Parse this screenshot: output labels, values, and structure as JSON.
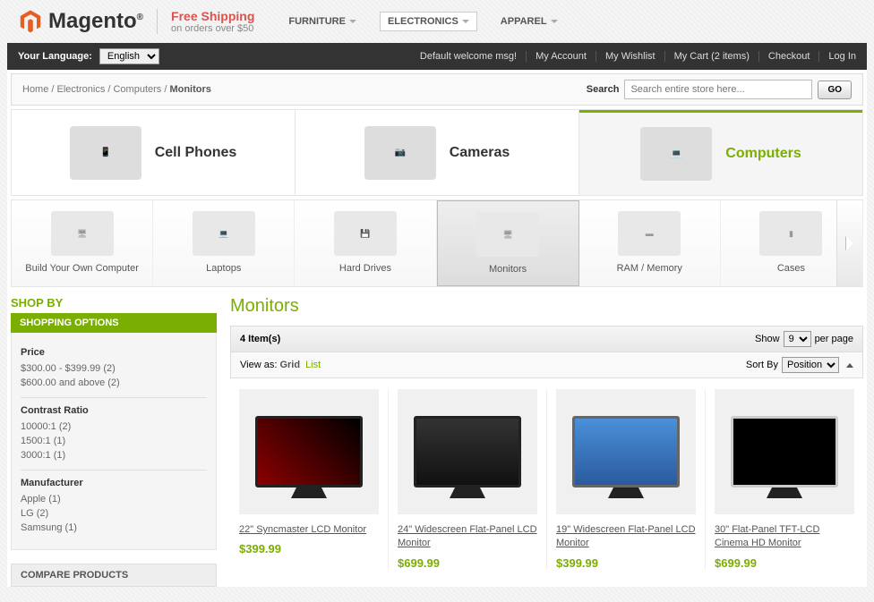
{
  "header": {
    "logo": "Magento",
    "reg": "®",
    "ship_title": "Free Shipping",
    "ship_sub": "on orders over $50",
    "nav": [
      "FURNITURE",
      "ELECTRONICS",
      "APPAREL"
    ]
  },
  "toolbar": {
    "lang_label": "Your Language:",
    "lang_value": "English",
    "welcome": "Default welcome msg!",
    "links": [
      "My Account",
      "My Wishlist",
      "My Cart (2 items)",
      "Checkout",
      "Log In"
    ]
  },
  "breadcrumb": {
    "items": [
      "Home",
      "Electronics",
      "Computers"
    ],
    "current": "Monitors",
    "sep": " / "
  },
  "search": {
    "label": "Search",
    "placeholder": "Search entire store here...",
    "go": "GO"
  },
  "catbanner": [
    {
      "label": "Cell Phones"
    },
    {
      "label": "Cameras"
    },
    {
      "label": "Computers"
    }
  ],
  "subcat": [
    "Build Your Own Computer",
    "Laptops",
    "Hard Drives",
    "Monitors",
    "RAM / Memory",
    "Cases"
  ],
  "sidebar": {
    "title": "SHOP BY",
    "options_title": "SHOPPING OPTIONS",
    "groups": [
      {
        "title": "Price",
        "opts": [
          "$300.00 - $399.99 (2)",
          "$600.00 and above (2)"
        ]
      },
      {
        "title": "Contrast Ratio",
        "opts": [
          "10000:1 (2)",
          "1500:1 (1)",
          "3000:1 (1)"
        ]
      },
      {
        "title": "Manufacturer",
        "opts": [
          "Apple (1)",
          "LG (2)",
          "Samsung (1)"
        ]
      }
    ],
    "compare": "COMPARE PRODUCTS"
  },
  "listing": {
    "title": "Monitors",
    "count": "4 Item(s)",
    "show_label": "Show",
    "show_val": "9",
    "perpage": "per page",
    "viewas": "View as:",
    "grid": "Grid",
    "list": "List",
    "sortby": "Sort By",
    "sort_val": "Position",
    "products": [
      {
        "name": "22\" Syncmaster LCD Monitor",
        "price": "$399.99"
      },
      {
        "name": "24\" Widescreen Flat-Panel LCD Monitor",
        "price": "$699.99"
      },
      {
        "name": "19\" Widescreen Flat-Panel LCD Monitor",
        "price": "$399.99"
      },
      {
        "name": "30\" Flat-Panel TFT-LCD Cinema HD Monitor",
        "price": "$699.99"
      }
    ]
  }
}
